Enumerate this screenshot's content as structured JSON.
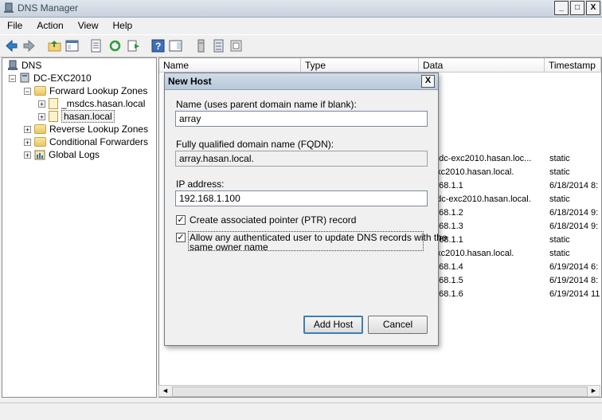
{
  "window": {
    "title": "DNS Manager",
    "min": "_",
    "max": "□",
    "close": "X"
  },
  "menu": [
    "File",
    "Action",
    "View",
    "Help"
  ],
  "tree": {
    "root": "DNS",
    "server": "DC-EXC2010",
    "forward": "Forward Lookup Zones",
    "zone1": "_msdcs.hasan.local",
    "zone2": "hasan.local",
    "reverse": "Reverse Lookup Zones",
    "conditional": "Conditional Forwarders",
    "logs": "Global Logs"
  },
  "columns": [
    "Name",
    "Type",
    "Data",
    "Timestamp"
  ],
  "rows": [
    {
      "data": "], dc-exc2010.hasan.loc...",
      "ts": "static"
    },
    {
      "data": "exc2010.hasan.local.",
      "ts": "static"
    },
    {
      "data": ".168.1.1",
      "ts": "6/18/2014 8:"
    },
    {
      "data": "]  dc-exc2010.hasan.local.",
      "ts": "static"
    },
    {
      "data": ".168.1.2",
      "ts": "6/18/2014 9:"
    },
    {
      "data": ".168.1.3",
      "ts": "6/18/2014 9:"
    },
    {
      "data": ".168.1.1",
      "ts": "static"
    },
    {
      "data": "exc2010.hasan.local.",
      "ts": "static"
    },
    {
      "data": ".168.1.4",
      "ts": "6/19/2014 6:"
    },
    {
      "data": ".168.1.5",
      "ts": "6/19/2014 8:"
    },
    {
      "data": ".168.1.6",
      "ts": "6/19/2014 11"
    }
  ],
  "dialog": {
    "title": "New Host",
    "close": "X",
    "name_label": "Name (uses parent domain name if blank):",
    "name_value": "array",
    "fqdn_label": "Fully qualified domain name (FQDN):",
    "fqdn_value": "array.hasan.local.",
    "ip_label": "IP address:",
    "ip_value": "192.168.1.100",
    "ptr_label": "Create associated pointer (PTR) record",
    "ptr_checked": true,
    "auth_label_1": "Allow any authenticated user to update DNS records with the",
    "auth_label_2": "same owner name",
    "auth_checked": true,
    "check_mark": "✓",
    "add_button": "Add Host",
    "cancel_button": "Cancel"
  },
  "scroll": {
    "left": "◄",
    "right": "►"
  }
}
